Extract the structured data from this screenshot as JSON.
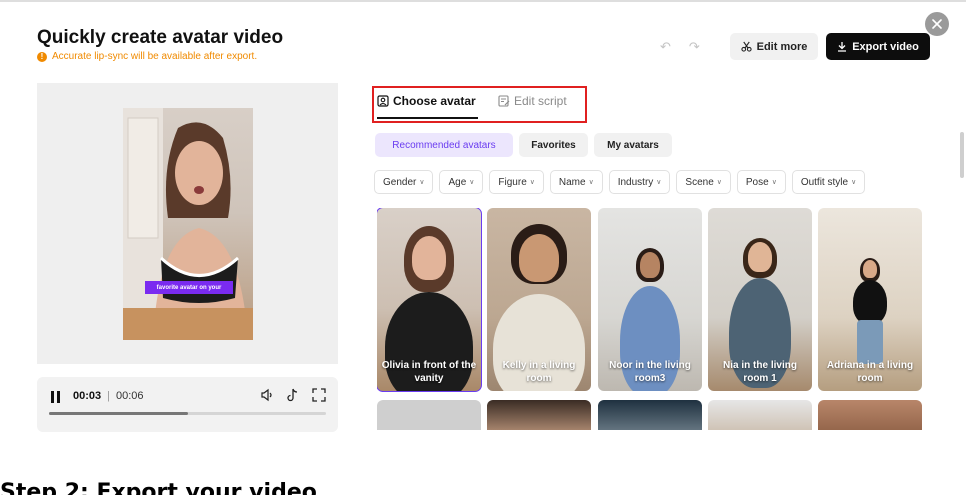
{
  "header": {
    "title": "Quickly create avatar video",
    "warning": "Accurate lip-sync will be available after export.",
    "edit_more_label": "Edit more",
    "export_label": "Export video"
  },
  "preview": {
    "caption": "favorite avatar on your"
  },
  "player": {
    "current_time": "00:03",
    "separator": "|",
    "duration": "00:06",
    "progress_fraction": 0.5
  },
  "tabs": [
    {
      "label": "Choose avatar",
      "active": true
    },
    {
      "label": "Edit script",
      "active": false
    }
  ],
  "filters": {
    "pills": [
      "Recommended avatars",
      "Favorites",
      "My avatars"
    ],
    "dropdowns": [
      "Gender",
      "Age",
      "Figure",
      "Name",
      "Industry",
      "Scene",
      "Pose",
      "Outfit style"
    ]
  },
  "avatars": [
    {
      "name": "Olivia in front of the vanity",
      "selected": true
    },
    {
      "name": "Kelly in a living room",
      "selected": false
    },
    {
      "name": "Noor in the living room3",
      "selected": false
    },
    {
      "name": "Nia in the living room 1",
      "selected": false
    },
    {
      "name": "Adriana in a living room",
      "selected": false
    }
  ],
  "colors": {
    "accent": "#6a3cf0",
    "warning": "#f08a00",
    "highlight_box": "#e02020"
  },
  "bottom_heading": "Step 2: Export your video"
}
